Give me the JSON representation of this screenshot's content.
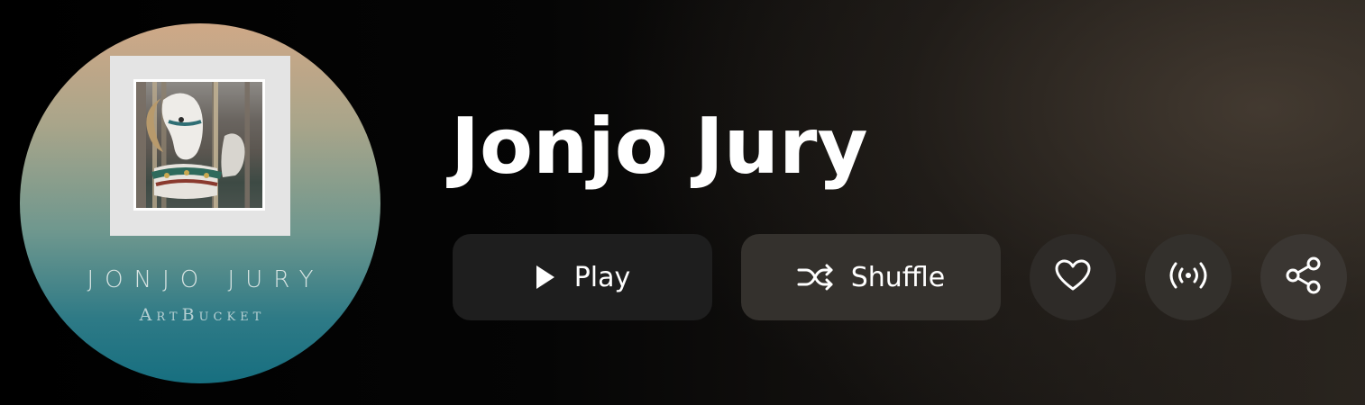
{
  "artist": {
    "name": "Jonjo Jury",
    "avatar_text": {
      "name": "JONJO JURY",
      "label": "ArtBucket"
    }
  },
  "actions": {
    "play_label": "Play",
    "shuffle_label": "Shuffle"
  },
  "icons": {
    "play": "play-icon",
    "shuffle": "shuffle-icon",
    "like": "heart-icon",
    "radio": "broadcast-icon",
    "share": "share-icon"
  },
  "colors": {
    "background": "#000000",
    "text": "#ffffff",
    "play_button": "#1e1e1e",
    "shuffle_button": "#34312d",
    "avatar_top": "#cfa887",
    "avatar_bottom": "#176f80"
  }
}
